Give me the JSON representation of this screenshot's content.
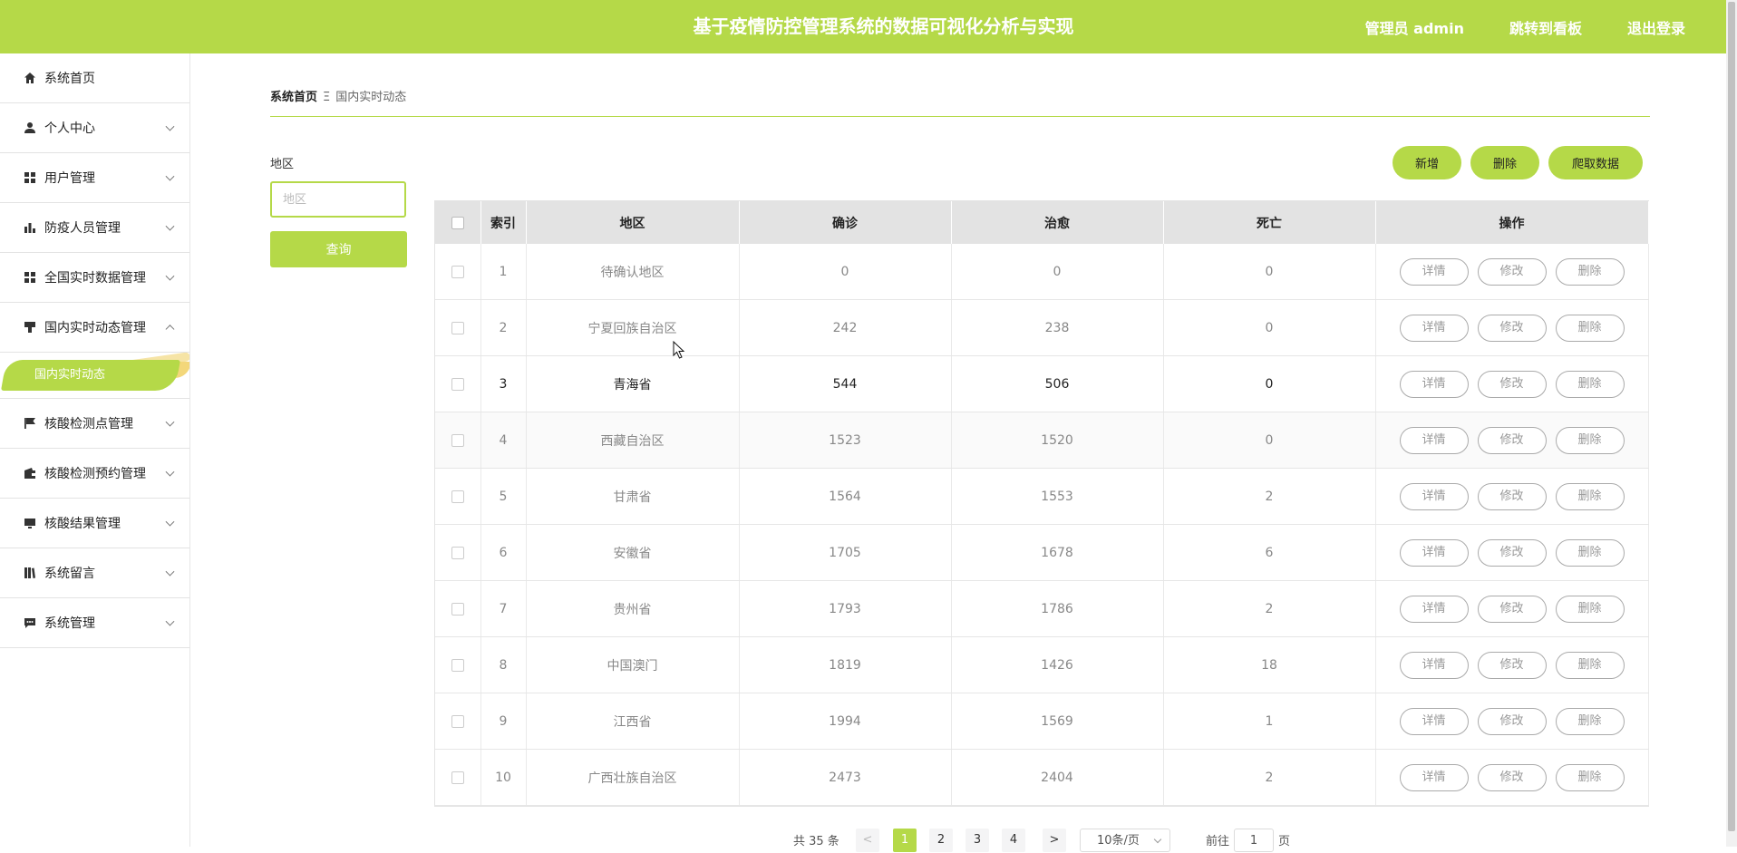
{
  "header": {
    "title": "基于疫情防控管理系统的数据可视化分析与实现",
    "admin_label": "管理员 admin",
    "dashboard_link": "跳转到看板",
    "logout_link": "退出登录"
  },
  "sidebar": {
    "items": [
      {
        "label": "系统首页",
        "icon": "home-icon"
      },
      {
        "label": "个人中心",
        "icon": "user-icon"
      },
      {
        "label": "用户管理",
        "icon": "grid-icon"
      },
      {
        "label": "防疫人员管理",
        "icon": "bar-chart-icon"
      },
      {
        "label": "全国实时数据管理",
        "icon": "grid-icon"
      },
      {
        "label": "国内实时动态管理",
        "icon": "brush-icon"
      },
      {
        "label": "核酸检测点管理",
        "icon": "flag-icon"
      },
      {
        "label": "核酸检测预约管理",
        "icon": "wallet-icon"
      },
      {
        "label": "核酸结果管理",
        "icon": "monitor-icon"
      },
      {
        "label": "系统留言",
        "icon": "book-icon"
      },
      {
        "label": "系统管理",
        "icon": "chat-icon"
      }
    ],
    "sub_item": "国内实时动态"
  },
  "breadcrumb": {
    "home": "系统首页",
    "separator": "Ξ",
    "current": "国内实时动态"
  },
  "search": {
    "label": "地区",
    "placeholder": "地区",
    "button": "查询"
  },
  "actions": {
    "add": "新增",
    "delete": "删除",
    "crawl": "爬取数据"
  },
  "table": {
    "headers": [
      "索引",
      "地区",
      "确诊",
      "治愈",
      "死亡",
      "操作"
    ],
    "rows": [
      {
        "index": "1",
        "region": "待确认地区",
        "confirmed": "0",
        "cured": "0",
        "dead": "0"
      },
      {
        "index": "2",
        "region": "宁夏回族自治区",
        "confirmed": "242",
        "cured": "238",
        "dead": "0"
      },
      {
        "index": "3",
        "region": "青海省",
        "confirmed": "544",
        "cured": "506",
        "dead": "0"
      },
      {
        "index": "4",
        "region": "西藏自治区",
        "confirmed": "1523",
        "cured": "1520",
        "dead": "0"
      },
      {
        "index": "5",
        "region": "甘肃省",
        "confirmed": "1564",
        "cured": "1553",
        "dead": "2"
      },
      {
        "index": "6",
        "region": "安徽省",
        "confirmed": "1705",
        "cured": "1678",
        "dead": "6"
      },
      {
        "index": "7",
        "region": "贵州省",
        "confirmed": "1793",
        "cured": "1786",
        "dead": "2"
      },
      {
        "index": "8",
        "region": "中国澳门",
        "confirmed": "1819",
        "cured": "1426",
        "dead": "18"
      },
      {
        "index": "9",
        "region": "江西省",
        "confirmed": "1994",
        "cured": "1569",
        "dead": "1"
      },
      {
        "index": "10",
        "region": "广西壮族自治区",
        "confirmed": "2473",
        "cured": "2404",
        "dead": "2"
      }
    ],
    "row_actions": {
      "detail": "详情",
      "edit": "修改",
      "delete": "删除"
    }
  },
  "pagination": {
    "total": "共 35 条",
    "prev": "<",
    "next": ">",
    "pages": [
      "1",
      "2",
      "3",
      "4"
    ],
    "page_size": "10条/页",
    "goto_prefix": "前往",
    "goto_value": "1",
    "goto_suffix": "页"
  },
  "colors": {
    "accent": "#b5d948"
  }
}
